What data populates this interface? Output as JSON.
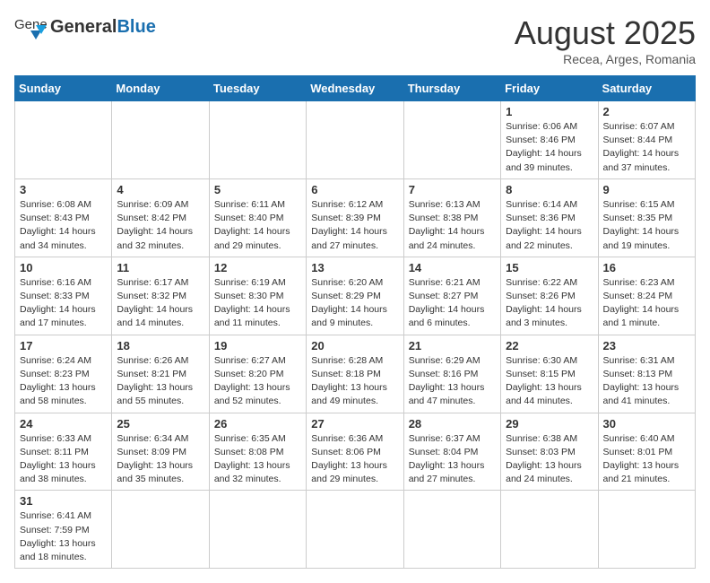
{
  "header": {
    "logo_general": "General",
    "logo_blue": "Blue",
    "month_title": "August 2025",
    "subtitle": "Recea, Arges, Romania"
  },
  "weekdays": [
    "Sunday",
    "Monday",
    "Tuesday",
    "Wednesday",
    "Thursday",
    "Friday",
    "Saturday"
  ],
  "weeks": [
    [
      {
        "day": "",
        "info": ""
      },
      {
        "day": "",
        "info": ""
      },
      {
        "day": "",
        "info": ""
      },
      {
        "day": "",
        "info": ""
      },
      {
        "day": "",
        "info": ""
      },
      {
        "day": "1",
        "info": "Sunrise: 6:06 AM\nSunset: 8:46 PM\nDaylight: 14 hours and 39 minutes."
      },
      {
        "day": "2",
        "info": "Sunrise: 6:07 AM\nSunset: 8:44 PM\nDaylight: 14 hours and 37 minutes."
      }
    ],
    [
      {
        "day": "3",
        "info": "Sunrise: 6:08 AM\nSunset: 8:43 PM\nDaylight: 14 hours and 34 minutes."
      },
      {
        "day": "4",
        "info": "Sunrise: 6:09 AM\nSunset: 8:42 PM\nDaylight: 14 hours and 32 minutes."
      },
      {
        "day": "5",
        "info": "Sunrise: 6:11 AM\nSunset: 8:40 PM\nDaylight: 14 hours and 29 minutes."
      },
      {
        "day": "6",
        "info": "Sunrise: 6:12 AM\nSunset: 8:39 PM\nDaylight: 14 hours and 27 minutes."
      },
      {
        "day": "7",
        "info": "Sunrise: 6:13 AM\nSunset: 8:38 PM\nDaylight: 14 hours and 24 minutes."
      },
      {
        "day": "8",
        "info": "Sunrise: 6:14 AM\nSunset: 8:36 PM\nDaylight: 14 hours and 22 minutes."
      },
      {
        "day": "9",
        "info": "Sunrise: 6:15 AM\nSunset: 8:35 PM\nDaylight: 14 hours and 19 minutes."
      }
    ],
    [
      {
        "day": "10",
        "info": "Sunrise: 6:16 AM\nSunset: 8:33 PM\nDaylight: 14 hours and 17 minutes."
      },
      {
        "day": "11",
        "info": "Sunrise: 6:17 AM\nSunset: 8:32 PM\nDaylight: 14 hours and 14 minutes."
      },
      {
        "day": "12",
        "info": "Sunrise: 6:19 AM\nSunset: 8:30 PM\nDaylight: 14 hours and 11 minutes."
      },
      {
        "day": "13",
        "info": "Sunrise: 6:20 AM\nSunset: 8:29 PM\nDaylight: 14 hours and 9 minutes."
      },
      {
        "day": "14",
        "info": "Sunrise: 6:21 AM\nSunset: 8:27 PM\nDaylight: 14 hours and 6 minutes."
      },
      {
        "day": "15",
        "info": "Sunrise: 6:22 AM\nSunset: 8:26 PM\nDaylight: 14 hours and 3 minutes."
      },
      {
        "day": "16",
        "info": "Sunrise: 6:23 AM\nSunset: 8:24 PM\nDaylight: 14 hours and 1 minute."
      }
    ],
    [
      {
        "day": "17",
        "info": "Sunrise: 6:24 AM\nSunset: 8:23 PM\nDaylight: 13 hours and 58 minutes."
      },
      {
        "day": "18",
        "info": "Sunrise: 6:26 AM\nSunset: 8:21 PM\nDaylight: 13 hours and 55 minutes."
      },
      {
        "day": "19",
        "info": "Sunrise: 6:27 AM\nSunset: 8:20 PM\nDaylight: 13 hours and 52 minutes."
      },
      {
        "day": "20",
        "info": "Sunrise: 6:28 AM\nSunset: 8:18 PM\nDaylight: 13 hours and 49 minutes."
      },
      {
        "day": "21",
        "info": "Sunrise: 6:29 AM\nSunset: 8:16 PM\nDaylight: 13 hours and 47 minutes."
      },
      {
        "day": "22",
        "info": "Sunrise: 6:30 AM\nSunset: 8:15 PM\nDaylight: 13 hours and 44 minutes."
      },
      {
        "day": "23",
        "info": "Sunrise: 6:31 AM\nSunset: 8:13 PM\nDaylight: 13 hours and 41 minutes."
      }
    ],
    [
      {
        "day": "24",
        "info": "Sunrise: 6:33 AM\nSunset: 8:11 PM\nDaylight: 13 hours and 38 minutes."
      },
      {
        "day": "25",
        "info": "Sunrise: 6:34 AM\nSunset: 8:09 PM\nDaylight: 13 hours and 35 minutes."
      },
      {
        "day": "26",
        "info": "Sunrise: 6:35 AM\nSunset: 8:08 PM\nDaylight: 13 hours and 32 minutes."
      },
      {
        "day": "27",
        "info": "Sunrise: 6:36 AM\nSunset: 8:06 PM\nDaylight: 13 hours and 29 minutes."
      },
      {
        "day": "28",
        "info": "Sunrise: 6:37 AM\nSunset: 8:04 PM\nDaylight: 13 hours and 27 minutes."
      },
      {
        "day": "29",
        "info": "Sunrise: 6:38 AM\nSunset: 8:03 PM\nDaylight: 13 hours and 24 minutes."
      },
      {
        "day": "30",
        "info": "Sunrise: 6:40 AM\nSunset: 8:01 PM\nDaylight: 13 hours and 21 minutes."
      }
    ],
    [
      {
        "day": "31",
        "info": "Sunrise: 6:41 AM\nSunset: 7:59 PM\nDaylight: 13 hours and 18 minutes."
      },
      {
        "day": "",
        "info": ""
      },
      {
        "day": "",
        "info": ""
      },
      {
        "day": "",
        "info": ""
      },
      {
        "day": "",
        "info": ""
      },
      {
        "day": "",
        "info": ""
      },
      {
        "day": "",
        "info": ""
      }
    ]
  ]
}
